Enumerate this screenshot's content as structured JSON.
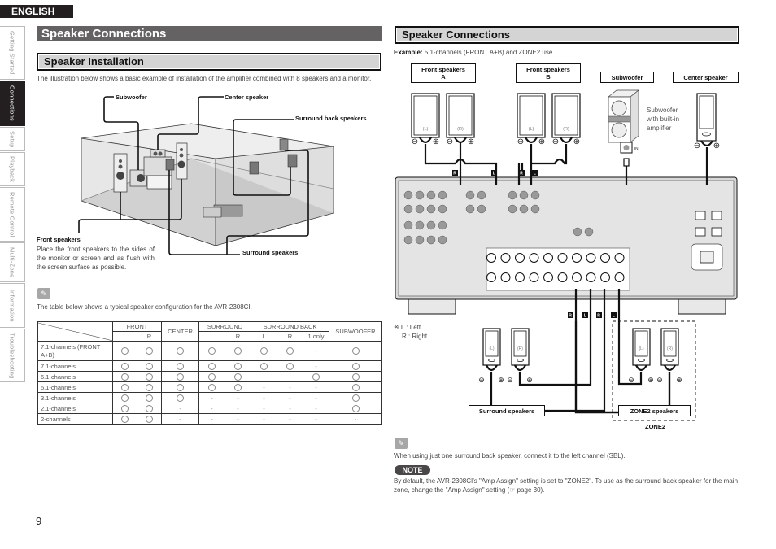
{
  "language_tab": "ENGLISH",
  "side_tabs": [
    {
      "label": "Getting Started",
      "active": false
    },
    {
      "label": "Connections",
      "active": true
    },
    {
      "label": "Setup",
      "active": false
    },
    {
      "label": "Playback",
      "active": false
    },
    {
      "label": "Remote Control",
      "active": false
    },
    {
      "label": "Multi-Zone",
      "active": false
    },
    {
      "label": "Information",
      "active": false
    },
    {
      "label": "Troubleshooting",
      "active": false
    }
  ],
  "left": {
    "title": "Speaker Connections",
    "section_title": "Speaker Installation",
    "intro": "The illustration below shows a basic example of installation of the amplifier combined with 8 speakers and a monitor.",
    "illustration_labels": {
      "subwoofer": "Subwoofer",
      "center": "Center speaker",
      "surround_back": "Surround back speakers",
      "front": "Front speakers",
      "surround": "Surround speakers"
    },
    "front_desc": "Place the front speakers to the sides of the monitor or screen and as flush with the screen surface as possible.",
    "pencil_icon": "pencil-icon",
    "table_caption": "The table below shows a typical speaker configuration for the AVR-2308CI.",
    "table": {
      "groups": [
        "FRONT",
        "CENTER",
        "SURROUND",
        "SURROUND BACK",
        "SUBWOOFER"
      ],
      "subheaders": [
        "L",
        "R",
        "L",
        "R",
        "L",
        "R",
        "1 only"
      ],
      "rows": [
        {
          "label": "7.1-channels (FRONT A+B)",
          "cells": [
            "o",
            "o",
            "o",
            "o",
            "o",
            "o",
            "o",
            "-",
            "o"
          ]
        },
        {
          "label": "7.1-channels",
          "cells": [
            "o",
            "o",
            "o",
            "o",
            "o",
            "o",
            "o",
            "-",
            "o"
          ]
        },
        {
          "label": "6.1-channels",
          "cells": [
            "o",
            "o",
            "o",
            "o",
            "o",
            "-",
            "-",
            "o",
            "o"
          ]
        },
        {
          "label": "5.1-channels",
          "cells": [
            "o",
            "o",
            "o",
            "o",
            "o",
            "-",
            "-",
            "-",
            "o"
          ]
        },
        {
          "label": "3.1-channels",
          "cells": [
            "o",
            "o",
            "o",
            "-",
            "-",
            "-",
            "-",
            "-",
            "o"
          ]
        },
        {
          "label": "2.1-channels",
          "cells": [
            "o",
            "o",
            "-",
            "-",
            "-",
            "-",
            "-",
            "-",
            "o"
          ]
        },
        {
          "label": "2-channels",
          "cells": [
            "o",
            "o",
            "-",
            "-",
            "-",
            "-",
            "-",
            "-",
            "-"
          ]
        }
      ]
    }
  },
  "right": {
    "section_title": "Speaker Connections",
    "example_label": "Example:",
    "example_text": "5.1-channels (FRONT A+B) and ZONE2 use",
    "boxes": {
      "front_a": "Front speakers\nA",
      "front_b": "Front speakers\nB",
      "subwoofer": "Subwoofer",
      "center": "Center speaker",
      "surround": "Surround speakers",
      "zone2_speakers": "ZONE2 speakers",
      "zone2": "ZONE2"
    },
    "sub_desc": "Subwoofer\nwith built-in\namplifier",
    "sub_in": "IN",
    "channel_marks": {
      "left": "(L)",
      "right": "(R)",
      "minus": "⊖",
      "plus": "⊕"
    },
    "terminal_tags": [
      "R",
      "L",
      "R",
      "L",
      "R",
      "L",
      "R",
      "L"
    ],
    "legend": [
      "※ L : Left",
      "R : Right"
    ],
    "pencil_text": "When using just one surround back speaker, connect it to the left channel (SBL).",
    "note_label": "NOTE",
    "note_text": "By default, the AVR-2308CI's \"Amp Assign\" setting is set to \"ZONE2\". To use as the surround back speaker for the main zone, change the \"Amp Assign\" setting (☞ page 30)."
  },
  "page_number": "9",
  "colors": {
    "dark": "#231f20",
    "title_bar": "#656263",
    "section_bar": "#d4d4d4",
    "room_floor": "#bdbdbd"
  }
}
